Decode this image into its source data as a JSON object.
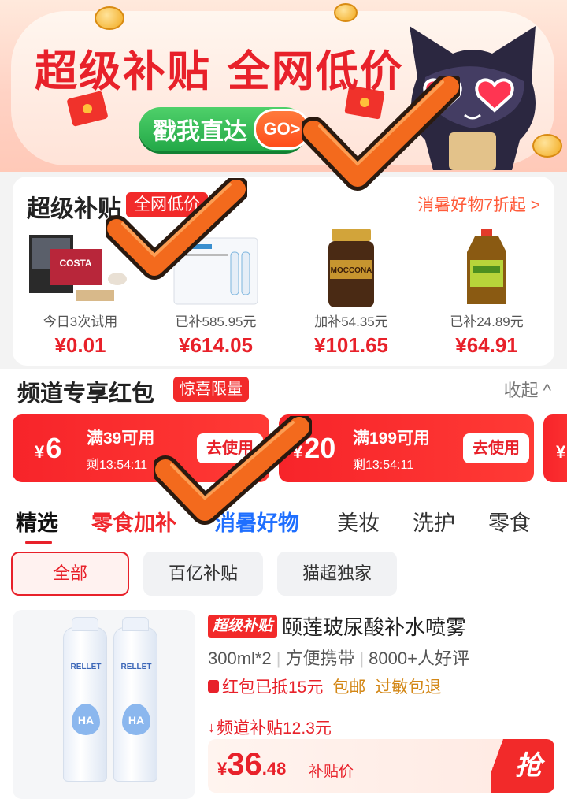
{
  "banner": {
    "headline": "超级补贴 全网低价",
    "cta_label": "戳我直达",
    "go_label": "GO>"
  },
  "subsidy_card": {
    "title": "超级补贴",
    "tag": "全网低价",
    "right_link": "消暑好物7折起 >",
    "products": [
      {
        "img_text": "COSTA",
        "note": "今日3次试用",
        "price": "¥0.01"
      },
      {
        "img_text": "",
        "note": "已补585.95元",
        "price": "¥614.05"
      },
      {
        "img_text": "MOCCONA",
        "note": "加补54.35元",
        "price": "¥101.65"
      },
      {
        "img_text": "",
        "note": "已补24.89元",
        "price": "¥64.91"
      }
    ]
  },
  "redpacket": {
    "title": "频道专享红包",
    "tag": "惊喜限量",
    "collapse_label": "收起 ^",
    "coupons": [
      {
        "yen": "¥",
        "amount": "6",
        "condition": "满39可用",
        "timer": "剩13:54:11",
        "button": "去使用"
      },
      {
        "yen": "¥",
        "amount": "20",
        "condition": "满199可用",
        "timer": "剩13:54:11",
        "button": "去使用"
      },
      {
        "yen": "¥",
        "amount": "",
        "condition": "",
        "timer": "",
        "button": ""
      }
    ]
  },
  "tabs": [
    "精选",
    "零食加补",
    "消暑好物",
    "美妆",
    "洗护",
    "零食"
  ],
  "filters": [
    "全部",
    "百亿补贴",
    "猫超独家"
  ],
  "item": {
    "badge": "超级补贴",
    "name": "颐莲玻尿酸补水喷雾",
    "brand": "RELLET",
    "drop_text": "HA",
    "specs": [
      "300ml*2",
      "方便携带",
      "8000+人好评"
    ],
    "benefit_redpacket": "红包已抵15元",
    "benefit_free_shipping": "包邮",
    "benefit_return": "过敏包退",
    "subsidy": "频道补贴12.3元",
    "price_yen": "¥",
    "price_int": "36",
    "price_dec": ".48",
    "price_label": "补贴价",
    "buy_label": "抢"
  },
  "colors": {
    "brand_red": "#e8212a",
    "banner_green": "#22a847",
    "subsidy_blue": "#1f6fff",
    "check_orange": "#f36a1d"
  }
}
